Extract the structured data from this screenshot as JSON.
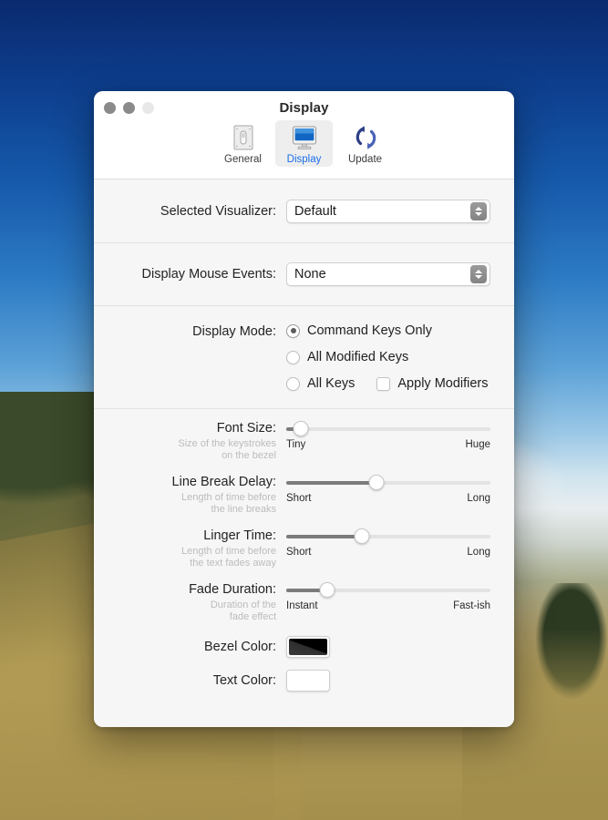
{
  "window": {
    "title": "Display",
    "traffic_lights": [
      "close",
      "minimize",
      "zoom"
    ]
  },
  "toolbar": {
    "items": [
      {
        "label": "General",
        "icon": "switchplate-icon",
        "selected": false
      },
      {
        "label": "Display",
        "icon": "monitor-icon",
        "selected": true
      },
      {
        "label": "Update",
        "icon": "refresh-arrows-icon",
        "selected": false
      }
    ],
    "selected_tint": "#1a6ee8"
  },
  "fields": {
    "visualizer": {
      "label": "Selected Visualizer:",
      "value": "Default"
    },
    "mouse_events": {
      "label": "Display Mouse Events:",
      "value": "None"
    },
    "display_mode": {
      "label": "Display Mode:",
      "options": [
        {
          "label": "Command Keys Only",
          "selected": true
        },
        {
          "label": "All Modified Keys",
          "selected": false
        },
        {
          "label": "All Keys",
          "selected": false
        }
      ],
      "apply_modifiers": {
        "label": "Apply Modifiers",
        "checked": false
      }
    }
  },
  "sliders": [
    {
      "label": "Font Size:",
      "sublabel": "Size of the keystrokes\non the bezel",
      "min_label": "Tiny",
      "max_label": "Huge",
      "percent": 7
    },
    {
      "label": "Line Break Delay:",
      "sublabel": "Length of time before\nthe line breaks",
      "min_label": "Short",
      "max_label": "Long",
      "percent": 44
    },
    {
      "label": "Linger Time:",
      "sublabel": "Length of time before\nthe text fades away",
      "min_label": "Short",
      "max_label": "Long",
      "percent": 37
    },
    {
      "label": "Fade Duration:",
      "sublabel": "Duration of the\nfade effect",
      "min_label": "Instant",
      "max_label": "Fast-ish",
      "percent": 20
    }
  ],
  "colors": [
    {
      "label": "Bezel Color:",
      "value": "#111111",
      "name": "bezel-color-well"
    },
    {
      "label": "Text Color:",
      "value": "#ffffff",
      "name": "text-color-well"
    }
  ]
}
